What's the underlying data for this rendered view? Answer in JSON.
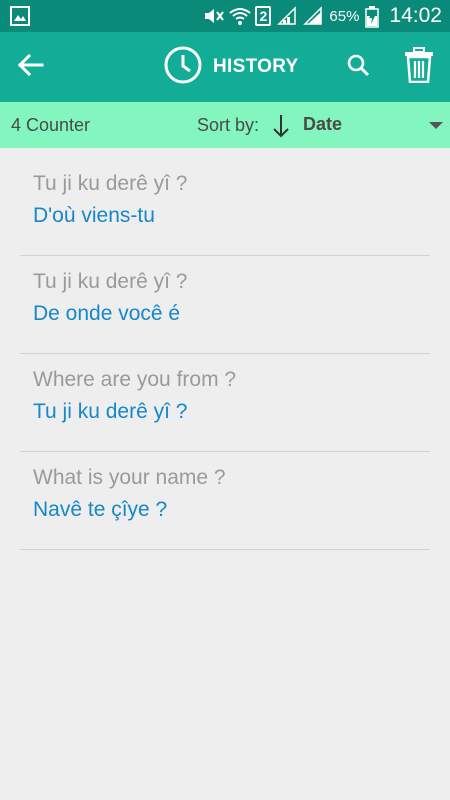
{
  "status_bar": {
    "battery_percent": "65%",
    "sim_slot": "2",
    "time": "14:02",
    "icons": [
      "gallery-icon",
      "mute-icon",
      "wifi-icon",
      "sim-icon",
      "signal-icon",
      "signal-icon",
      "battery-charging-icon"
    ]
  },
  "app_bar": {
    "title": "HISTORY",
    "back_icon": "arrow-left-icon",
    "title_icon": "clock-icon",
    "search_icon": "search-icon",
    "delete_icon": "trash-icon",
    "color": "#13ad97"
  },
  "sort_bar": {
    "counter": "4 Counter",
    "sort_label": "Sort by:",
    "sort_value": "Date",
    "color": "#83f5be"
  },
  "history": [
    {
      "source": "Tu ji ku derê yî ?",
      "target": "D'où viens-tu"
    },
    {
      "source": "Tu ji ku derê yî ?",
      "target": "De onde você é"
    },
    {
      "source": "Where are you from ?",
      "target": "Tu ji ku derê yî ?"
    },
    {
      "source": "What is your name ?",
      "target": "Navê te çîye ?"
    }
  ]
}
